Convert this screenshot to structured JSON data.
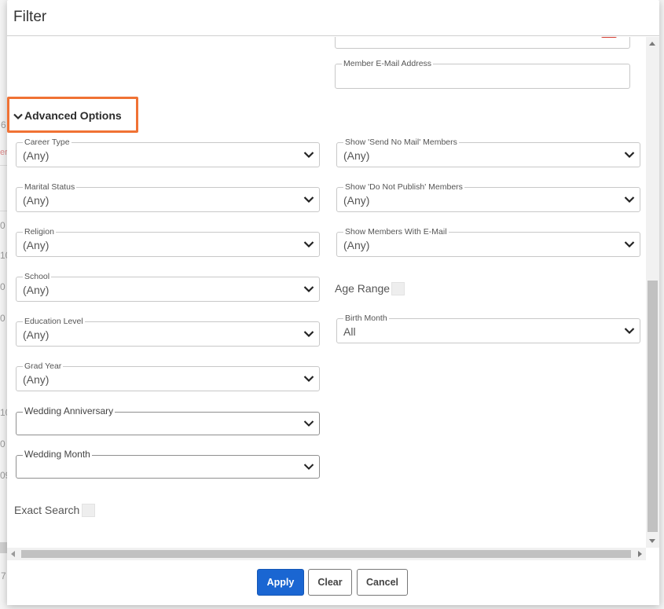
{
  "dialog": {
    "title": "Filter"
  },
  "top_fields": {
    "member_email_label": "Member E-Mail Address",
    "member_email_value": ""
  },
  "advanced": {
    "label": "Advanced Options"
  },
  "left_selects": [
    {
      "label": "Career Type",
      "value": "(Any)"
    },
    {
      "label": "Marital Status",
      "value": "(Any)"
    },
    {
      "label": "Religion",
      "value": "(Any)"
    },
    {
      "label": "School",
      "value": "(Any)"
    },
    {
      "label": "Education Level",
      "value": "(Any)"
    },
    {
      "label": "Grad Year",
      "value": "(Any)"
    }
  ],
  "right_selects": [
    {
      "label": "Show 'Send No Mail' Members",
      "value": "(Any)"
    },
    {
      "label": "Show 'Do Not Publish' Members",
      "value": "(Any)"
    },
    {
      "label": "Show Members With E-Mail",
      "value": "(Any)"
    }
  ],
  "age_range": {
    "label": "Age Range"
  },
  "birth_month": {
    "label": "Birth Month",
    "value": "All"
  },
  "wedding_anniversary": {
    "label": "Wedding Anniversary",
    "value": ""
  },
  "wedding_month": {
    "label": "Wedding Month",
    "value": ""
  },
  "exact_search": {
    "label": "Exact Search"
  },
  "buttons": {
    "apply": "Apply",
    "clear": "Clear",
    "cancel": "Cancel"
  },
  "colors": {
    "primary": "#1a66d2",
    "highlight": "#f07234"
  },
  "background_fragments": [
    "6",
    "er",
    "0",
    "10",
    "0",
    "0",
    "10",
    "0",
    "09",
    "7"
  ]
}
